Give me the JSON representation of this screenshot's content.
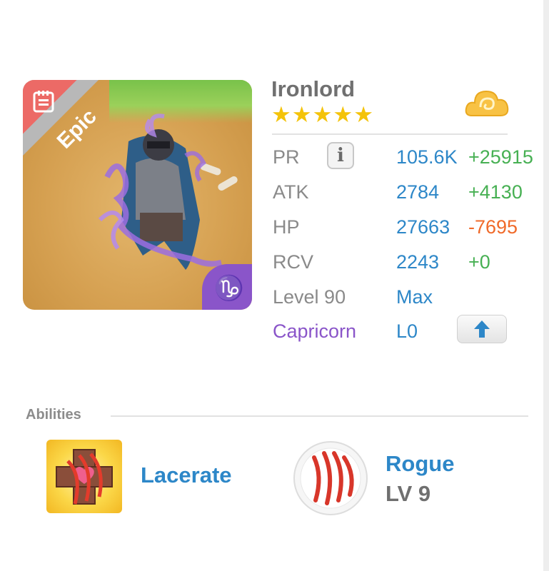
{
  "hero": {
    "name": "Ironlord",
    "stars": 5,
    "rarity": "Epic"
  },
  "stats": [
    {
      "label": "PR",
      "value": "105.6K",
      "bonus": "+25915"
    },
    {
      "label": "ATK",
      "value": "2784",
      "bonus": "+4130"
    },
    {
      "label": "HP",
      "value": "27663",
      "bonus": "-7695"
    },
    {
      "label": "RCV",
      "value": "2243",
      "bonus": "+0"
    }
  ],
  "level": {
    "label": "Level 90",
    "value": "Max"
  },
  "constellation": {
    "label": "Capricorn",
    "value": "L0"
  },
  "abilities": {
    "header": "Abilities",
    "skill": {
      "name": "Lacerate"
    },
    "class": {
      "name": "Rogue",
      "level": "LV 9"
    }
  },
  "colors": {
    "accent_blue": "#2d87c8",
    "bonus_positive": "#47b053",
    "bonus_negative": "#f06a2a",
    "zodiac_purple": "#8a55c9",
    "star_gold": "#f4c30a",
    "rarity_epic": "#ec6a66"
  },
  "icons": {
    "info": "info-icon",
    "upgrade": "arrow-up-icon",
    "element": "cloud-icon",
    "zodiac": "capricorn-icon",
    "note": "notes-icon"
  },
  "glyphs": {
    "zodiac": "♑",
    "info": "i",
    "star": "★"
  }
}
